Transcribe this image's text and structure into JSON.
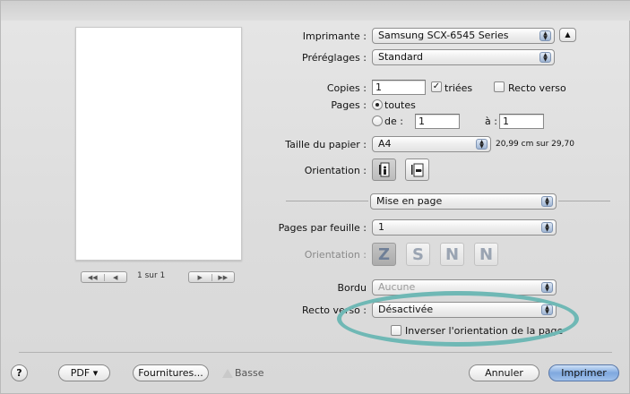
{
  "preview": {
    "page_indicator": "1 sur 1",
    "nav_first": "◀◀",
    "nav_prev": "◀",
    "nav_next": "▶",
    "nav_last": "▶▶"
  },
  "printer": {
    "label": "Imprimante :",
    "value": "Samsung SCX-6545 Series",
    "disclosure_icon": "▲"
  },
  "presets": {
    "label": "Préréglages :",
    "value": "Standard"
  },
  "copies": {
    "label": "Copies :",
    "value": "1",
    "collated_label": "triées",
    "collated_checked": true,
    "two_sided_label": "Recto verso",
    "two_sided_checked": false
  },
  "pages": {
    "label": "Pages :",
    "all_label": "toutes",
    "from_label": "de :",
    "from_value": "1",
    "to_label": "à :",
    "to_value": "1"
  },
  "paper_size": {
    "label": "Taille du papier :",
    "value": "A4",
    "dimensions": "20,99 cm sur 29,70"
  },
  "orientation": {
    "label": "Orientation :",
    "portrait_icon": "portrait-icon",
    "landscape_icon": "landscape-icon"
  },
  "section_popup": {
    "value": "Mise en page"
  },
  "layout": {
    "pages_per_sheet_label": "Pages par feuille :",
    "pages_per_sheet_value": "1",
    "orientation_label": "Orientation :",
    "layout_glyphs": [
      "Z",
      "S",
      "N",
      "N"
    ],
    "border_label": "Bordu",
    "border_value": "Aucune",
    "duplex_label": "Recto verso :",
    "duplex_value": "Désactivée",
    "reverse_label": "Inverser l'orientation de la page"
  },
  "footer": {
    "help": "?",
    "pdf": "PDF ▾",
    "supplies": "Fournitures...",
    "low_supply_label": "Basse",
    "cancel": "Annuler",
    "print": "Imprimer"
  },
  "colors": {
    "highlight_ring": "#6fb8b5",
    "default_button": "#7fa8df"
  }
}
